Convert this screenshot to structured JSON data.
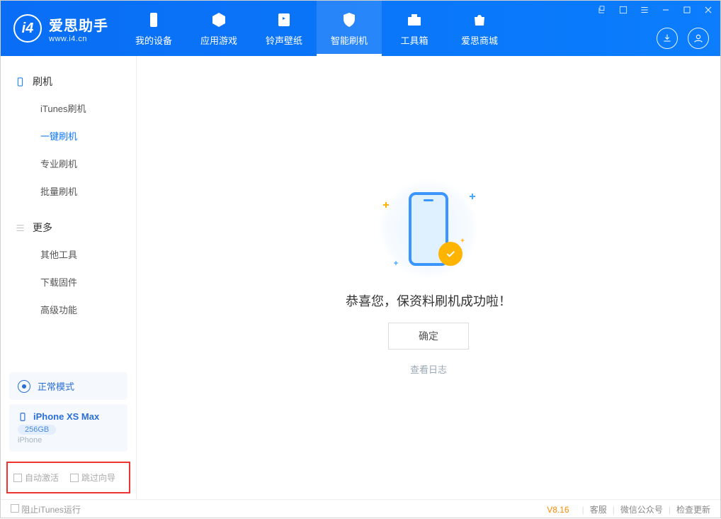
{
  "header": {
    "brand": "爱思助手",
    "url": "www.i4.cn",
    "nav": [
      {
        "label": "我的设备",
        "icon": "device"
      },
      {
        "label": "应用游戏",
        "icon": "cube"
      },
      {
        "label": "铃声壁纸",
        "icon": "music"
      },
      {
        "label": "智能刷机",
        "icon": "shield",
        "active": true
      },
      {
        "label": "工具箱",
        "icon": "toolbox"
      },
      {
        "label": "爱思商城",
        "icon": "bag"
      }
    ]
  },
  "sidebar": {
    "group1_title": "刷机",
    "group1_items": [
      {
        "label": "iTunes刷机"
      },
      {
        "label": "一键刷机",
        "active": true
      },
      {
        "label": "专业刷机"
      },
      {
        "label": "批量刷机"
      }
    ],
    "group2_title": "更多",
    "group2_items": [
      {
        "label": "其他工具"
      },
      {
        "label": "下载固件"
      },
      {
        "label": "高级功能"
      }
    ],
    "mode_label": "正常模式",
    "device_name": "iPhone XS Max",
    "device_storage": "256GB",
    "device_type": "iPhone",
    "chk_auto_activate": "自动激活",
    "chk_skip_wizard": "跳过向导"
  },
  "main": {
    "success_msg": "恭喜您，保资料刷机成功啦！",
    "ok_label": "确定",
    "log_label": "查看日志"
  },
  "bottom": {
    "block_itunes": "阻止iTunes运行",
    "version": "V8.16",
    "links": [
      "客服",
      "微信公众号",
      "检查更新"
    ]
  }
}
